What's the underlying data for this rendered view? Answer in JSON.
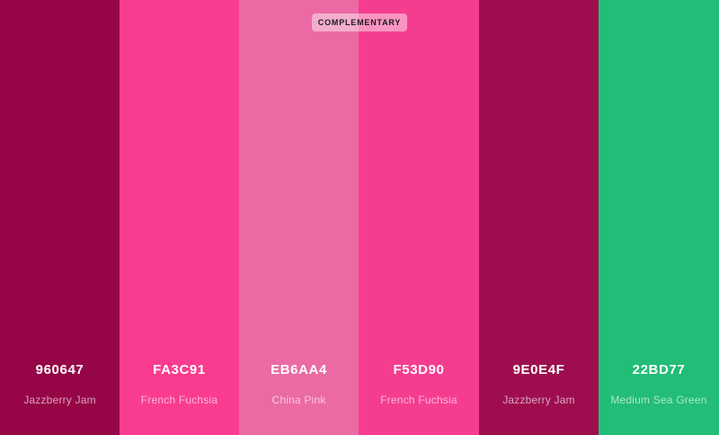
{
  "badge": {
    "label": "COMPLEMENTARY"
  },
  "swatches": [
    {
      "hex": "960647",
      "name": "Jazzberry Jam",
      "color": "#960647"
    },
    {
      "hex": "FA3C91",
      "name": "French Fuchsia",
      "color": "#FA3C91"
    },
    {
      "hex": "EB6AA4",
      "name": "China Pink",
      "color": "#EB6AA4"
    },
    {
      "hex": "F53D90",
      "name": "French Fuchsia",
      "color": "#F53D90"
    },
    {
      "hex": "9E0E4F",
      "name": "Jazzberry Jam",
      "color": "#9E0E4F"
    },
    {
      "hex": "22BD77",
      "name": "Medium Sea Green",
      "color": "#22BD77"
    }
  ]
}
